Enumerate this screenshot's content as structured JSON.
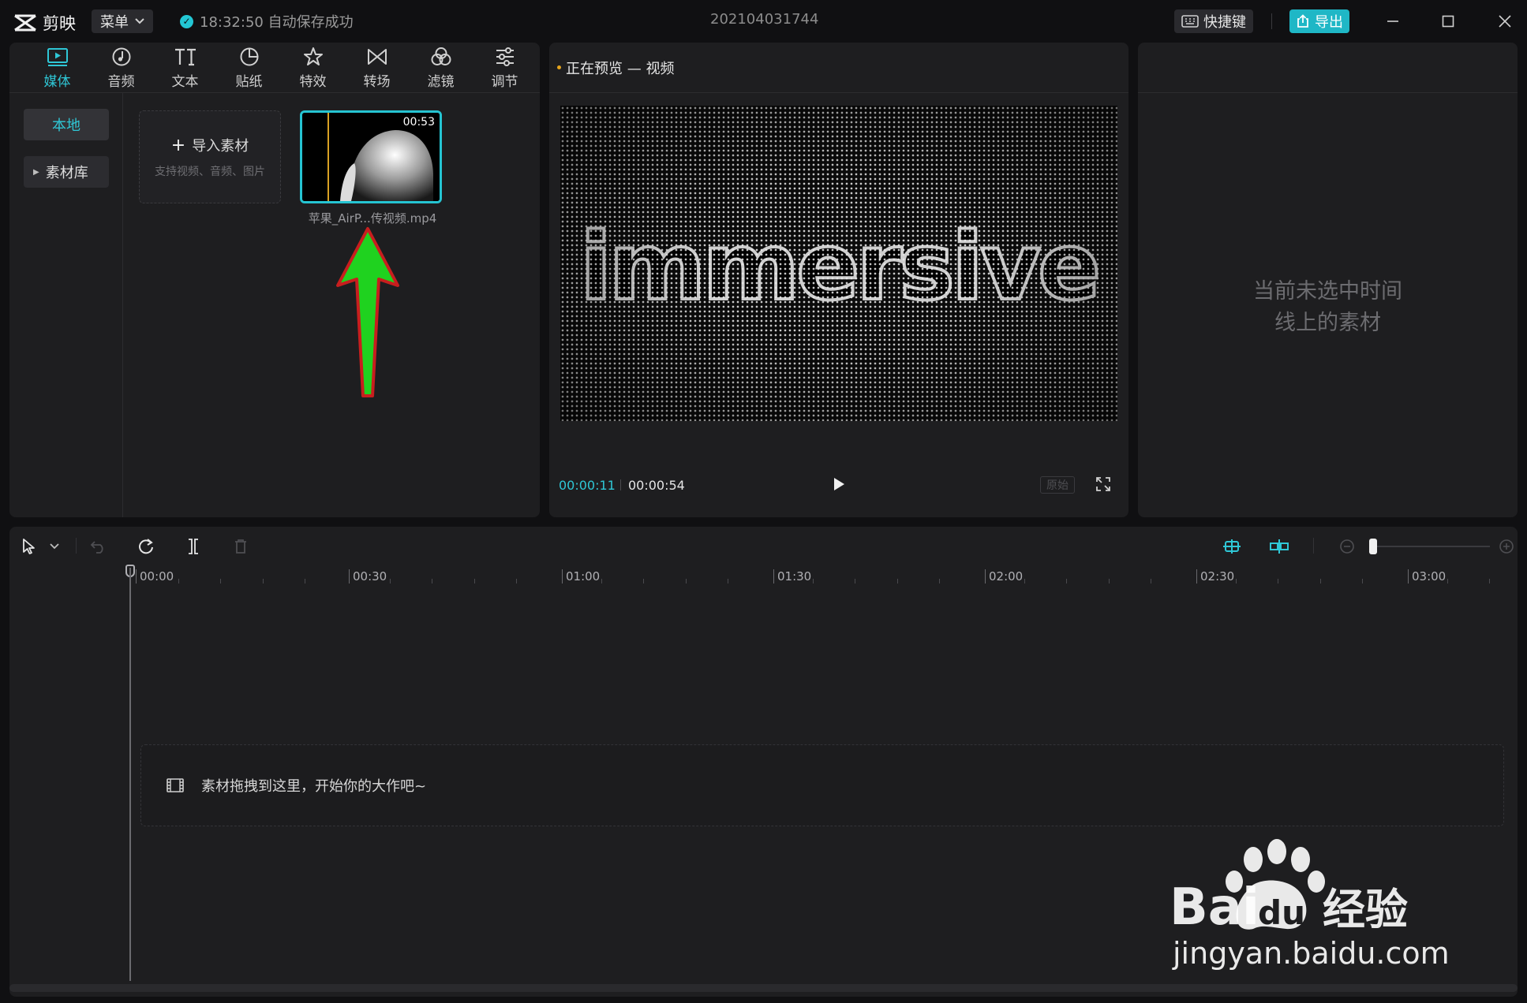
{
  "app": {
    "name": "剪映",
    "menu_label": "菜单",
    "save_status": "18:32:50 自动保存成功",
    "project_title": "202104031744",
    "shortcut_label": "快捷键",
    "export_label": "导出"
  },
  "media_tabs": [
    {
      "label": "媒体",
      "icon": "media-icon",
      "active": true
    },
    {
      "label": "音频",
      "icon": "audio-icon"
    },
    {
      "label": "文本",
      "icon": "text-icon"
    },
    {
      "label": "贴纸",
      "icon": "sticker-icon"
    },
    {
      "label": "特效",
      "icon": "effect-icon"
    },
    {
      "label": "转场",
      "icon": "transition-icon"
    },
    {
      "label": "滤镜",
      "icon": "filter-icon"
    },
    {
      "label": "调节",
      "icon": "adjust-icon"
    }
  ],
  "media_sidebar": {
    "local": "本地",
    "library": "素材库"
  },
  "import": {
    "title": "导入素材",
    "subtitle": "支持视频、音频、图片"
  },
  "clip": {
    "duration": "00:53",
    "filename": "苹果_AirP...传视频.mp4"
  },
  "preview": {
    "header": "正在预览 — 视频",
    "video_text": "immersive",
    "current_time": "00:00:11",
    "total_time": "00:00:54",
    "ratio_label": "原始"
  },
  "properties": {
    "empty_line1": "当前未选中时间",
    "empty_line2": "线上的素材"
  },
  "timeline": {
    "ruler_labels": [
      "00:00",
      "00:30",
      "01:00",
      "01:30",
      "02:00",
      "02:30",
      "03:00"
    ],
    "drop_hint": "素材拖拽到这里，开始你的大作吧~",
    "zoom_level": 0.05
  },
  "watermark": {
    "brand": "Bai du 经验",
    "url": "jingyan.baidu.com"
  },
  "colors": {
    "accent": "#25c4d2",
    "background": "#101012",
    "panel": "#1e1e20",
    "arrow_fill": "#1fd21f",
    "arrow_stroke": "#c81e1e"
  }
}
